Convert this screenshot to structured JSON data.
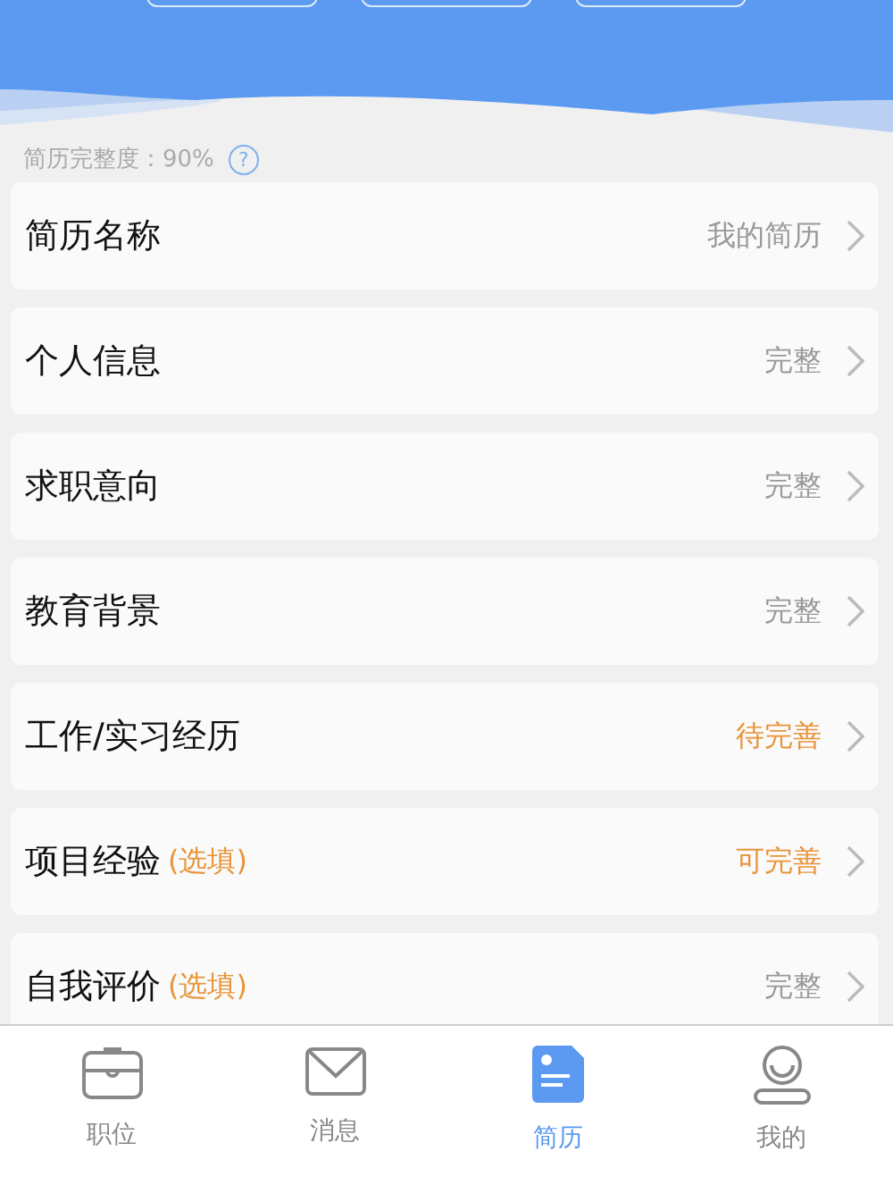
{
  "header": {
    "buttons": [
      {
        "kind": "pill"
      },
      {
        "kind": "pill"
      },
      {
        "kind": "pill"
      }
    ]
  },
  "completeness": {
    "label": "简历完整度：90%",
    "help_icon": "?"
  },
  "sections": [
    {
      "title": "简历名称",
      "status": "我的简历",
      "pending": false
    },
    {
      "title": "个人信息",
      "status": "完整",
      "pending": false
    },
    {
      "title": "求职意向",
      "status": "完整",
      "pending": false
    },
    {
      "title": "教育背景",
      "status": "完整",
      "pending": false
    },
    {
      "title": "工作/实习经历",
      "status": "待完善",
      "pending": true
    },
    {
      "title": "项目经验",
      "optional": "(选填)",
      "status": "可完善",
      "pending": true
    },
    {
      "title": "自我评价",
      "optional": "(选填)",
      "status": "完整",
      "pending": false
    }
  ],
  "tab_bar": [
    {
      "label": "职位",
      "kind": "briefcase",
      "selected": false
    },
    {
      "label": "消息",
      "kind": "mail",
      "selected": false
    },
    {
      "label": "简历",
      "kind": "document",
      "selected": true
    },
    {
      "label": "我的",
      "kind": "person",
      "selected": false
    }
  ]
}
